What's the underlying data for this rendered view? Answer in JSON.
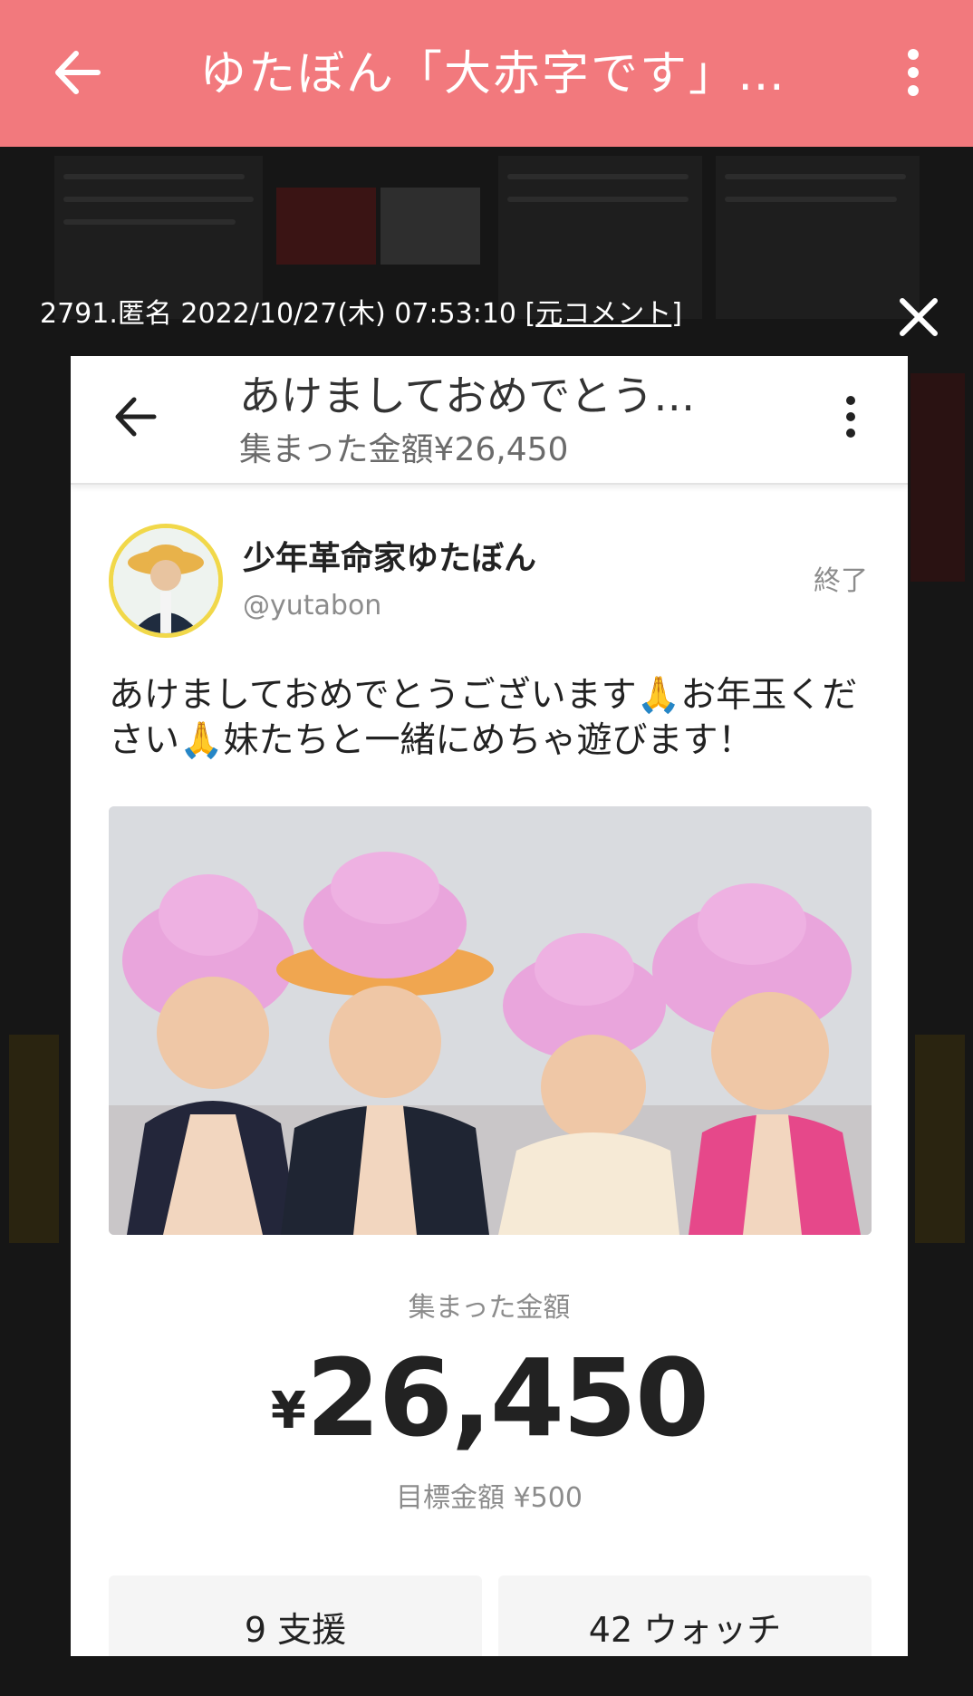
{
  "app_bar": {
    "title": "ゆたぼん「大赤字です」…",
    "back_icon": "arrow-left-icon",
    "menu_icon": "more-vertical-icon"
  },
  "comment": {
    "meta": "2791.匿名 2022/10/27(木) 07:53:10 ",
    "bracket_open": "[",
    "link_label": "元コメント",
    "bracket_close": "]",
    "close_icon": "close-icon"
  },
  "card": {
    "title": "あけましておめでとう…",
    "subtitle": "集まった金額¥26,450",
    "user_name": "少年革命家ゆたぼん",
    "user_handle": "@yutabon",
    "status": "終了",
    "message": "あけましておめでとうございます🙏お年玉ください🙏妹たちと一緒にめちゃ遊びます！",
    "collected_label": "集まった金額",
    "currency": "¥",
    "amount": "26,450",
    "goal": "目標金額 ¥500",
    "supporters": "9 支援",
    "watchers": "42 ウォッチ"
  },
  "colors": {
    "app_bar": "#f2797d",
    "background": "#161616",
    "avatar_ring": "#f1d84a"
  }
}
